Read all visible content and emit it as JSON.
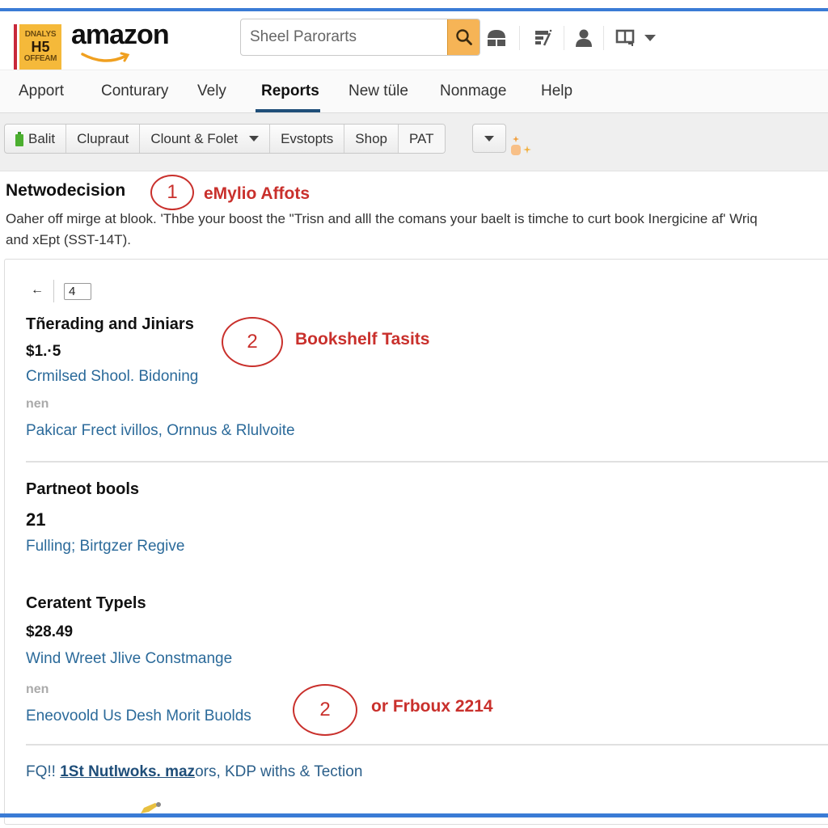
{
  "brand": {
    "badge_line1": "DNALYS",
    "badge_line2": "H5",
    "badge_line3": "OFFEAM",
    "wordmark": "amazon",
    "accent_color": "#f6b456",
    "rule_color": "#3a7bd5"
  },
  "search": {
    "placeholder": "Sheel Parorarts",
    "icon": "search-icon"
  },
  "header_icons": [
    "store-icon",
    "edit-icon",
    "user-icon",
    "display-icon",
    "chevron-down-icon"
  ],
  "nav": {
    "items": [
      {
        "label": "Apport"
      },
      {
        "label": "Conturary"
      },
      {
        "label": "Vely"
      },
      {
        "label": "Reports",
        "active": true
      },
      {
        "label": "New tüle"
      },
      {
        "label": "Nonmage"
      },
      {
        "label": "Help"
      }
    ]
  },
  "toolbar": {
    "buttons": [
      {
        "label": "Balit",
        "icon": "battery-icon"
      },
      {
        "label": "Clupraut"
      },
      {
        "label": "Clount & Folet",
        "dropdown": true
      },
      {
        "label": "Evstopts"
      },
      {
        "label": "Shop"
      },
      {
        "label": "PAT"
      }
    ],
    "more_icon": "caret-down-icon",
    "sparkle_icon": "sparkle-icon"
  },
  "intro": {
    "title": "Netwodecision",
    "annotation_number": "1",
    "annotation_label": "eMylio Affots",
    "description_line1": "Oaher off mirge at blook. 'Thbe your boost the \"Trisn and alll the comans your baelt is timche to curt book Inergicine af' Wriq",
    "description_line2": "and xEpt (SST-14T)."
  },
  "pager": {
    "back_icon": "arrow-left-icon",
    "page": "4"
  },
  "items": [
    {
      "title": "Tñerading and Jiniars",
      "price": "$1.·5",
      "link": "Crmilsed Shool. Bidoning",
      "muted": "nen",
      "link2": "Pakicar Frect ivillos, Ornnus & Rlulvoite",
      "annotation_number": "2",
      "annotation_label": "Bookshelf Tasits"
    },
    {
      "title": "Partneot bools",
      "count": "21",
      "link": "Fulling; Birtgzer Regive"
    },
    {
      "title": "Ceratent Typels",
      "price": "$28.49",
      "link": "Wind Wreet Jlive Constmange",
      "muted": "nen",
      "link2": "Eneovoold Us Desh Morit Buolds",
      "annotation_number": "2",
      "annotation_label": "or Frboux 2214"
    }
  ],
  "footer": {
    "prefix": "FQ!! ",
    "strong_link": "1St Nutlwoks. maz",
    "suffix": "ors, KDP withs & Tection"
  }
}
